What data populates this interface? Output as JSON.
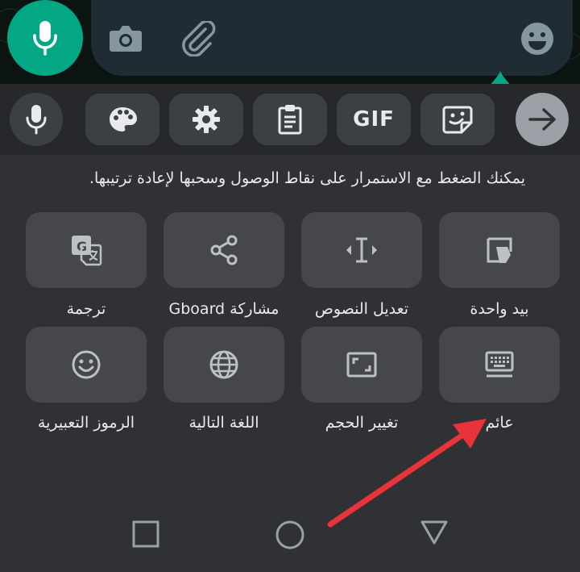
{
  "composer": {
    "mic_icon": "microphone-icon",
    "camera_icon": "camera-icon",
    "attach_icon": "paperclip-icon",
    "emoji_icon": "emoji-icon"
  },
  "toolbar": {
    "gif_label": "GIF",
    "items": [
      "microphone-icon",
      "palette-icon",
      "gear-icon",
      "clipboard-icon",
      "gif",
      "sticker-icon",
      "arrow-right-icon"
    ]
  },
  "hint": "يمكنك الضغط مع الاستمرار على نقاط الوصول وسحبها لإعادة ترتيبها.",
  "tiles": [
    {
      "label": "ترجمة",
      "icon": "translate-icon"
    },
    {
      "label": "مشاركة Gboard",
      "icon": "share-icon"
    },
    {
      "label": "تعديل النصوص",
      "icon": "text-cursor-icon"
    },
    {
      "label": "بيد واحدة",
      "icon": "one-handed-icon"
    },
    {
      "label": "الرموز التعبيرية",
      "icon": "emoji-icon"
    },
    {
      "label": "اللغة التالية",
      "icon": "globe-icon"
    },
    {
      "label": "تغيير الحجم",
      "icon": "resize-icon"
    },
    {
      "label": "عائم",
      "icon": "floating-keyboard-icon"
    }
  ],
  "navbar": [
    "recents-square-icon",
    "home-circle-icon",
    "back-triangle-icon"
  ],
  "colors": {
    "accent_green": "#04a784",
    "keyboard_bg": "#303134",
    "tile_bg": "#45474b",
    "annotation_arrow": "#e8333a"
  }
}
